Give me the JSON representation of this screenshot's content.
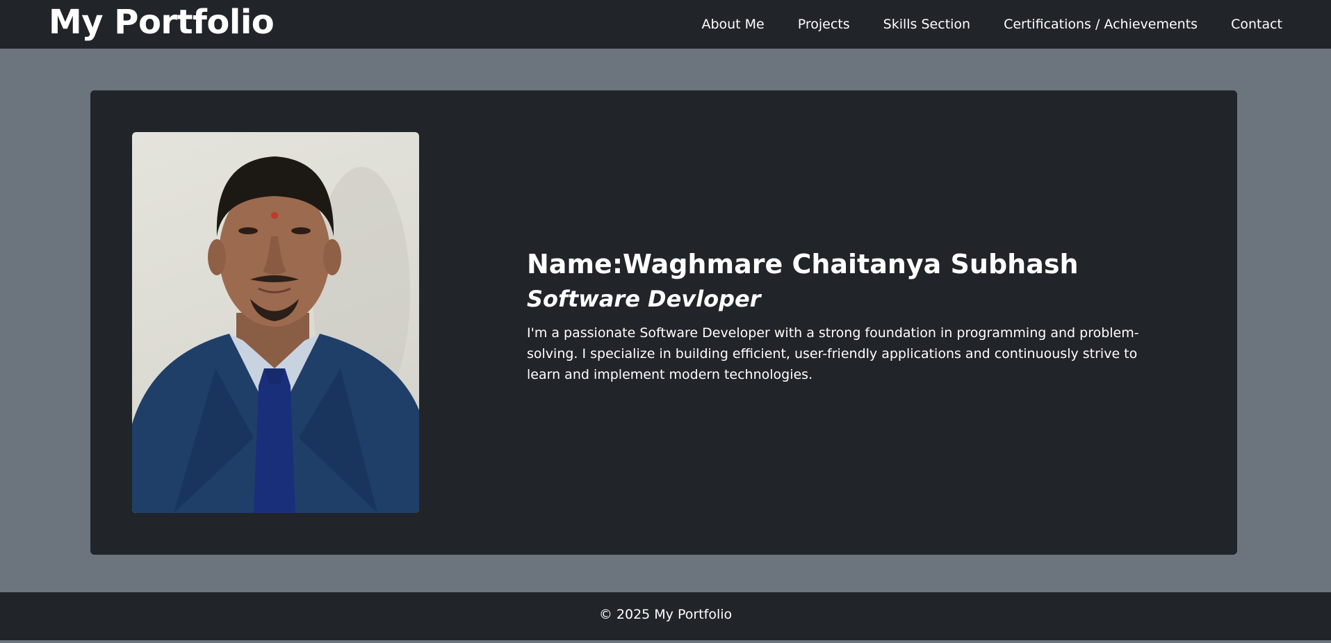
{
  "navbar": {
    "brand": "My Portfolio",
    "links": [
      {
        "label": "About Me"
      },
      {
        "label": "Projects"
      },
      {
        "label": "Skills Section"
      },
      {
        "label": "Certifications / Achievements"
      },
      {
        "label": "Contact"
      }
    ]
  },
  "hero": {
    "name": "Name:Waghmare Chaitanya Subhash",
    "role": "Software Devloper",
    "bio": "I'm a passionate Software Developer with a strong foundation in programming and problem-solving. I specialize in building efficient, user-friendly applications and continuously strive to learn and implement modern technologies."
  },
  "footer": {
    "copyright": "© 2025 My Portfolio"
  },
  "colors": {
    "dark": "#212529",
    "gray": "#6c757d",
    "text": "#ffffff"
  }
}
